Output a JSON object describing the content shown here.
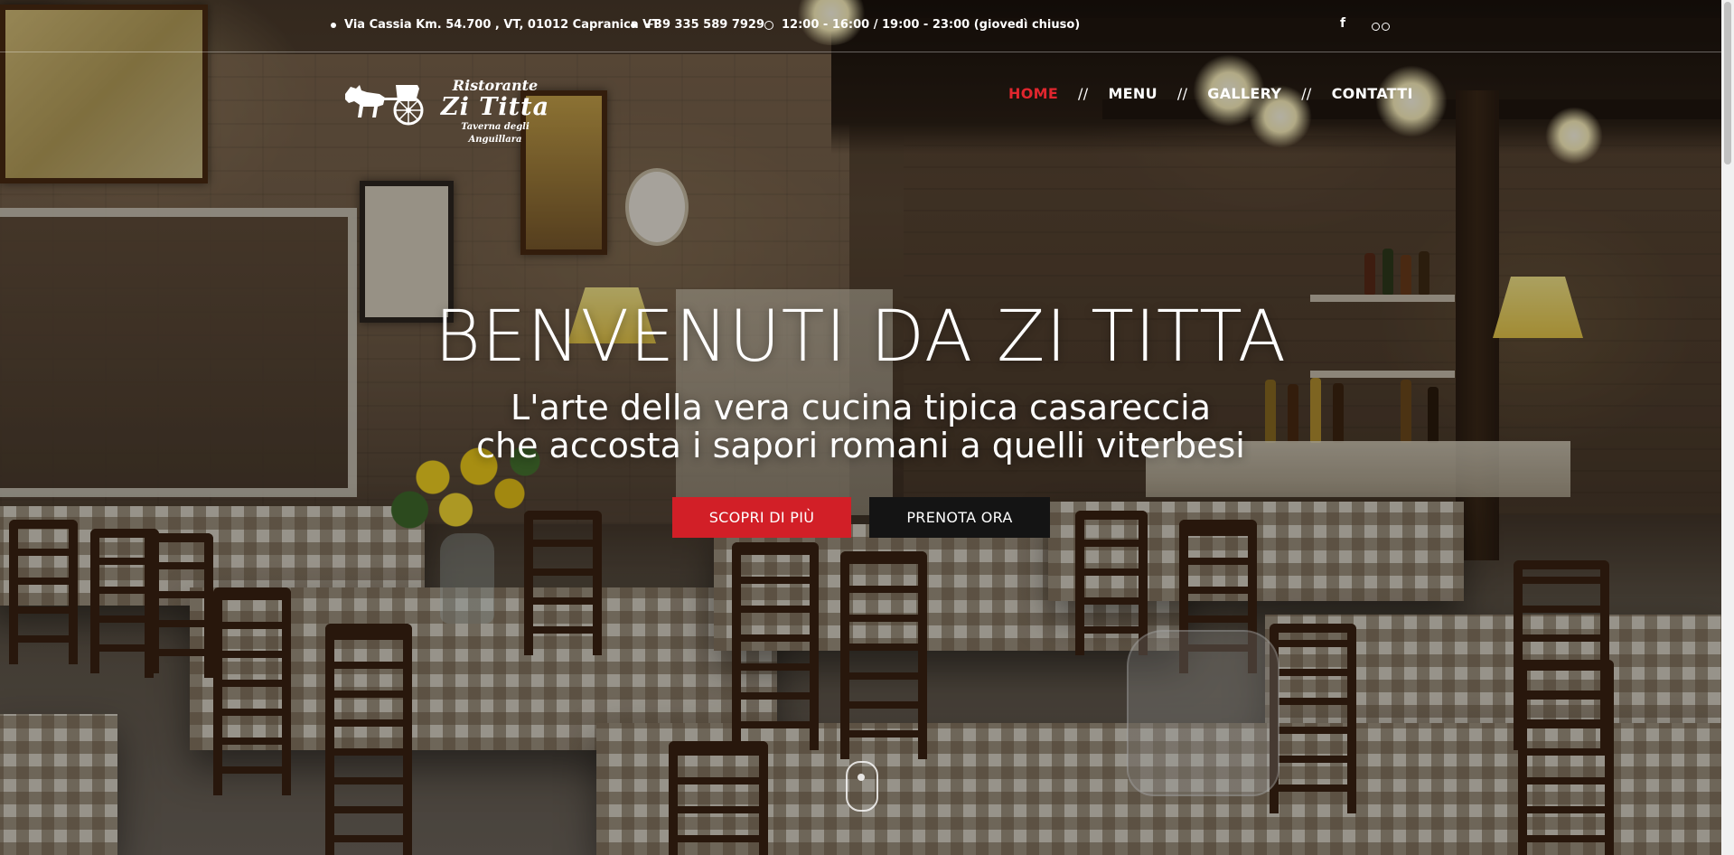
{
  "topbar": {
    "address": "Via Cassia Km. 54.700 , VT, 01012 Capranica VT",
    "phone": "+39 335 589 7929",
    "hours": "12:00 - 16:00 / 19:00 - 23:00 (giovedì chiuso)",
    "social": [
      {
        "icon": "facebook-icon",
        "label": "f"
      },
      {
        "icon": "tripadvisor-icon",
        "label": ""
      }
    ]
  },
  "logo": {
    "line1": "Ristorante",
    "line2": "Zi Titta",
    "line3": "Taverna degli Anguillara"
  },
  "nav": {
    "items": [
      {
        "label": "HOME",
        "active": true
      },
      {
        "label": "MENU",
        "active": false
      },
      {
        "label": "GALLERY",
        "active": false
      },
      {
        "label": "CONTATTI",
        "active": false
      }
    ],
    "separator": "//",
    "active_color": "#e0262e"
  },
  "hero": {
    "title": "BENVENUTI DA ZI TITTA",
    "subtitle_line1": "L'arte della vera cucina tipica casareccia",
    "subtitle_line2": "che accosta i sapori romani a quelli viterbesi",
    "primary_button": "SCOPRI DI PIÙ",
    "secondary_button": "PRENOTA ORA",
    "primary_color": "#d21f27",
    "secondary_color": "#141414"
  }
}
